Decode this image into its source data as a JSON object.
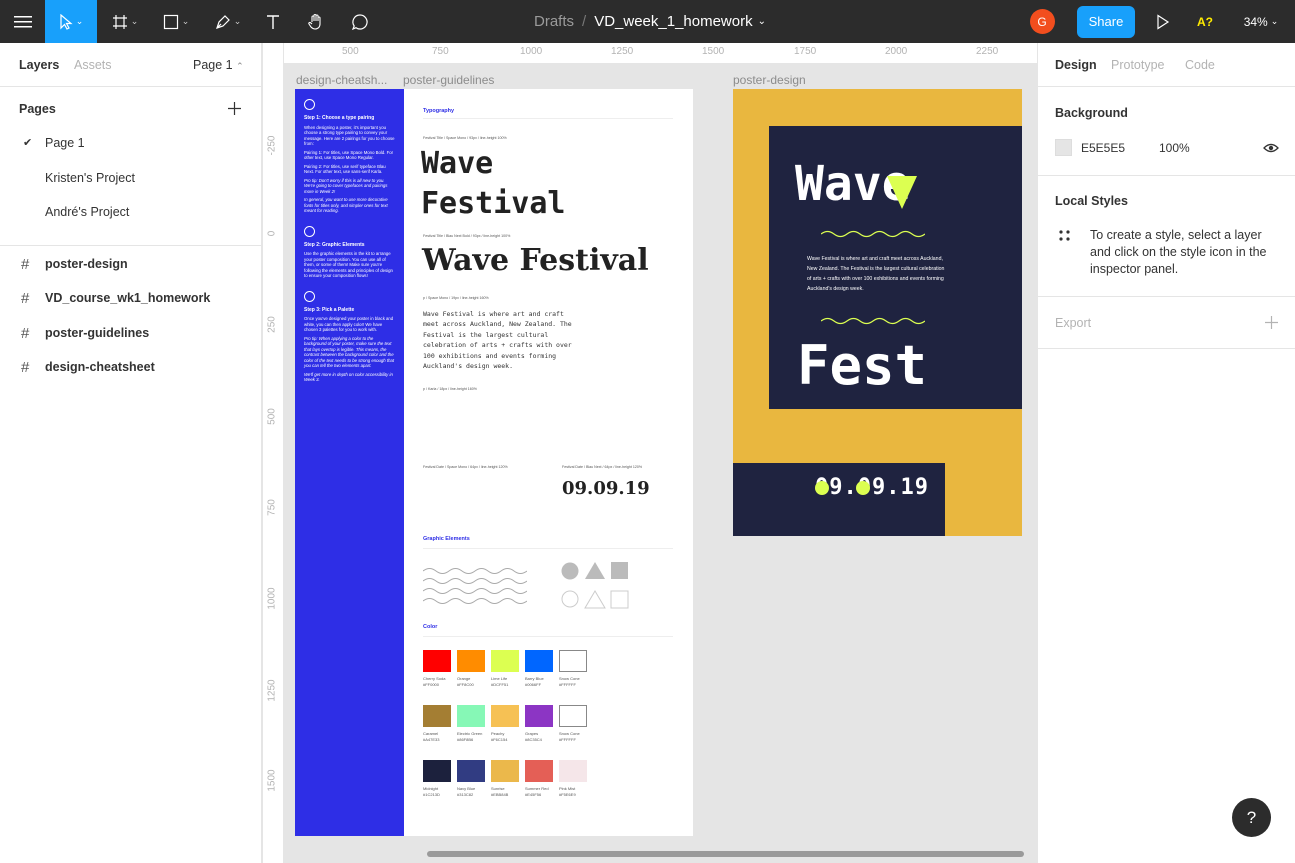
{
  "toolbar": {
    "breadcrumb_parent": "Drafts",
    "separator": "/",
    "file_name": "VD_week_1_homework",
    "avatar_letter": "G",
    "share_label": "Share",
    "font_warning": "A?",
    "zoom": "34%"
  },
  "left_panel": {
    "tabs": {
      "layers": "Layers",
      "assets": "Assets"
    },
    "page_switcher": "Page 1",
    "pages_heading": "Pages",
    "pages": [
      {
        "label": "Page 1",
        "selected": true
      },
      {
        "label": "Kristen's Project"
      },
      {
        "label": "André's Project"
      }
    ],
    "frames": [
      {
        "label": "poster-design"
      },
      {
        "label": "VD_course_wk1_homework"
      },
      {
        "label": "poster-guidelines"
      },
      {
        "label": "design-cheatsheet"
      }
    ]
  },
  "canvas": {
    "ruler_top": [
      "500",
      "750",
      "1000",
      "1250",
      "1500",
      "1750",
      "2000",
      "2250"
    ],
    "ruler_left": [
      "-250",
      "0",
      "250",
      "500",
      "750",
      "1000",
      "1250",
      "1500"
    ],
    "frame_labels": {
      "cheatsheet": "design-cheatsh...",
      "guidelines": "poster-guidelines",
      "poster": "poster-design"
    },
    "cheatsheet": {
      "step1_title": "Step 1: Choose a type pairing",
      "step1_body": "When designing a poster, it's important you choose a strong type pairing to convey your message. Here are 2 pairings for you to choose from:",
      "pairing1": "Pairing 1: For titles, use Space Mono Bold. For other text, use Space Mono Regular.",
      "pairing2": "Pairing 2: For titles, use serif typeface Blau Next. For other text, use sans-serif Karla.",
      "protip1": "Pro tip: Don't worry if this is all new to you. We're going to cover typefaces and pairings more in Week 2!",
      "note1": "In general, you want to use more decorative fonts for titles only, and simpler ones for text meant for reading.",
      "step2_title": "Step 2: Graphic Elements",
      "step2_body": "Use the graphic elements in the kit to arrange your poster composition. You can use all of them, or some of them! Make sure you're following the elements and principles of design to ensure your composition flows!",
      "step3_title": "Step 3: Pick a Palette",
      "step3_body": "Once you've designed your poster in black and white, you can then apply color! We have chosen 3 palettes for you to work with.",
      "protip3": "Pro tip: When applying a color to the background of your poster, make sure the text that lays overtop is legible. This means, the contrast between the background color and the color of the text needs to be strong enough that you can tell the two elements apart.",
      "note3": "We'll get more in depth on color accessibility in Week 3."
    },
    "guidelines": {
      "typography_heading": "Typography",
      "spec1": "Festival Title / Space Mono / 93px / line-height 100%",
      "sample1a": "Wave",
      "sample1b": "Festival",
      "spec2": "Festival Title / Blau Next Bold / 93px / line-height 100%",
      "sample2": "Wave Festival",
      "spec3": "p / Space Mono / 19px / line-height 160%",
      "body_sample": "Wave Festival is where art and craft meet across Auckland, New Zealand. The Festival is the largest cultural celebration of arts + crafts with over 100 exhibitions and events forming Auckland's design week.",
      "spec4": "p / Karla / 18px / line-height 160%",
      "spec5": "Festival Date / Space Mono / 64px / line-height 120%",
      "spec6": "Festival Date / Blau Next / 64px / line-height 120%",
      "date_sample": "09.09.19",
      "graphic_heading": "Graphic Elements",
      "color_heading": "Color",
      "swatches": [
        {
          "name": "Cherry Soda",
          "hex": "#FF0000"
        },
        {
          "name": "Orange",
          "hex": "#FF8C00"
        },
        {
          "name": "Lime Life",
          "hex": "#DCFF51"
        },
        {
          "name": "Barry Blue",
          "hex": "#0066FF"
        },
        {
          "name": "Snow Cone",
          "hex": "#FFFFFF"
        },
        {
          "name": "Caramel",
          "hex": "#A47E33"
        },
        {
          "name": "Electric Green",
          "hex": "#86F8B6"
        },
        {
          "name": "Peachy",
          "hex": "#F6C154"
        },
        {
          "name": "Grapes",
          "hex": "#8C35C4"
        },
        {
          "name": "Snow Cone",
          "hex": "#FFFFFF"
        },
        {
          "name": "Midnight",
          "hex": "#1C213D"
        },
        {
          "name": "Navy Blue",
          "hex": "#313C82"
        },
        {
          "name": "Sunrise",
          "hex": "#EBB84B"
        },
        {
          "name": "Summer Red",
          "hex": "#E45F56"
        },
        {
          "name": "Pink Mist",
          "hex": "#F5E6E9"
        }
      ]
    },
    "poster": {
      "title_top": "Wave",
      "body": "Wave Festival is where art and craft meet across Auckland, New Zealand. The Festival is the largest cultural celebration of arts + crafts with over 100 exhibitions and events forming Auckland's design week.",
      "title_bottom": "Fest",
      "date": "09.09.19"
    }
  },
  "right_panel": {
    "tabs": {
      "design": "Design",
      "prototype": "Prototype",
      "code": "Code"
    },
    "background_heading": "Background",
    "background_hex": "E5E5E5",
    "background_opacity": "100%",
    "local_styles_heading": "Local Styles",
    "local_styles_hint": "To create a style, select a layer and click on the style icon in the inspector panel.",
    "export_heading": "Export"
  },
  "help_label": "?",
  "colors": {
    "toolbar": "#2c2c2c",
    "active_tool": "#18a0fb",
    "share": "#18a0fb",
    "cheatsheet_blue": "#2e2ee6",
    "poster_yellow": "#e9b73f",
    "poster_navy": "#1f2340",
    "lime": "#dcff51",
    "avatar": "#f24e1e"
  }
}
